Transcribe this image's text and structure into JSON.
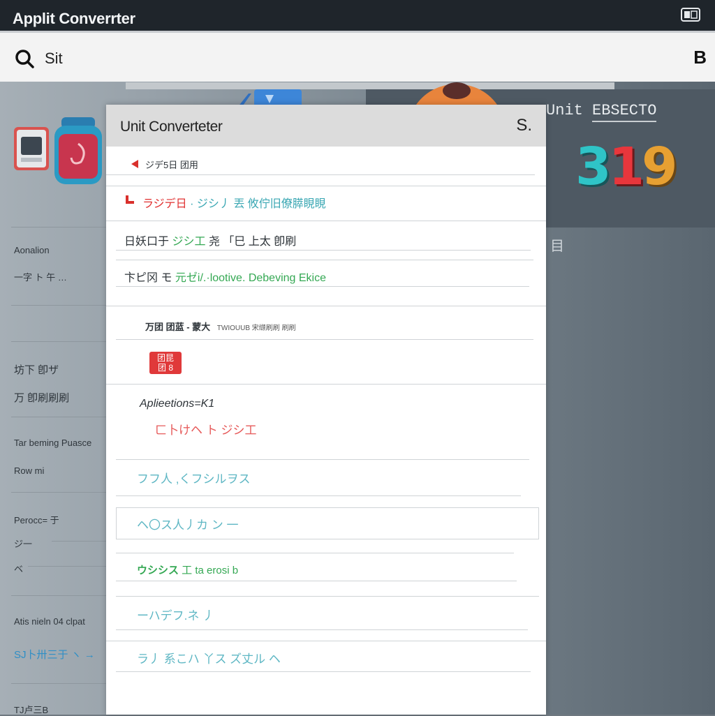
{
  "window": {
    "title": "Applit Converrter"
  },
  "search": {
    "query": "Sit",
    "right_button": "B"
  },
  "scene": {
    "unit_label": "Unit",
    "unit_value": "EBSECTO",
    "big_number": [
      "3",
      "1",
      "9"
    ],
    "side_glyph": "目"
  },
  "sidebar": {
    "items": [
      "Aonalion",
      "一字 ト 午 …",
      "坊下 卽ザ",
      "万 卽刷刷刷",
      "Tar beming Puasce",
      "Row mi",
      "Perocc= 于",
      "ジ一",
      "ベ",
      "Atis nieln 04 clpat",
      "SJ卜卅三于 ヽ →",
      "TJ卢三B"
    ]
  },
  "dialog": {
    "title": "Unit Converteter",
    "close_label": "S.",
    "rows": [
      {
        "text": "ジデ5日 团用"
      },
      {
        "prefix": "ラジデ日 ",
        "text": "· ジシ丿 丟 攸佇旧僚膵睍睍"
      },
      {
        "prefix": "日妖口于 ",
        "green": "ジシ工 ",
        "text": "尧 「巳 上太 卽刷"
      },
      {
        "prefix": "卞ピ冈 モ ",
        "green": "元ゼi/.",
        "text": "·lootive. Debeving Ekice"
      },
      {
        "text": "万团 团蓝 - 蒙大",
        "small": "TWIOUUB 宋缬刷刷 刷刷"
      },
      {
        "badge": "团昆\n团 8"
      },
      {
        "text": "Aplieetions=K1",
        "sub": "ㄈ卜けヘ ト ジシ工"
      },
      {
        "text": "フフ人 ,くフシルヲス"
      },
      {
        "text": "ヘ〇ス人丿カ ン 一"
      },
      {
        "green": "ウシシス ",
        "text": "工 ta erosi b"
      },
      {
        "text": "ーハデフ.ネ 丿"
      },
      {
        "text": "ラ丿 系こハ 丫ス ズ丈ル ヘ"
      }
    ]
  },
  "colors": {
    "titlebar": "#1f252b",
    "accent_red": "#e03030",
    "accent_green": "#34a853",
    "accent_teal": "#3aa7b3"
  }
}
